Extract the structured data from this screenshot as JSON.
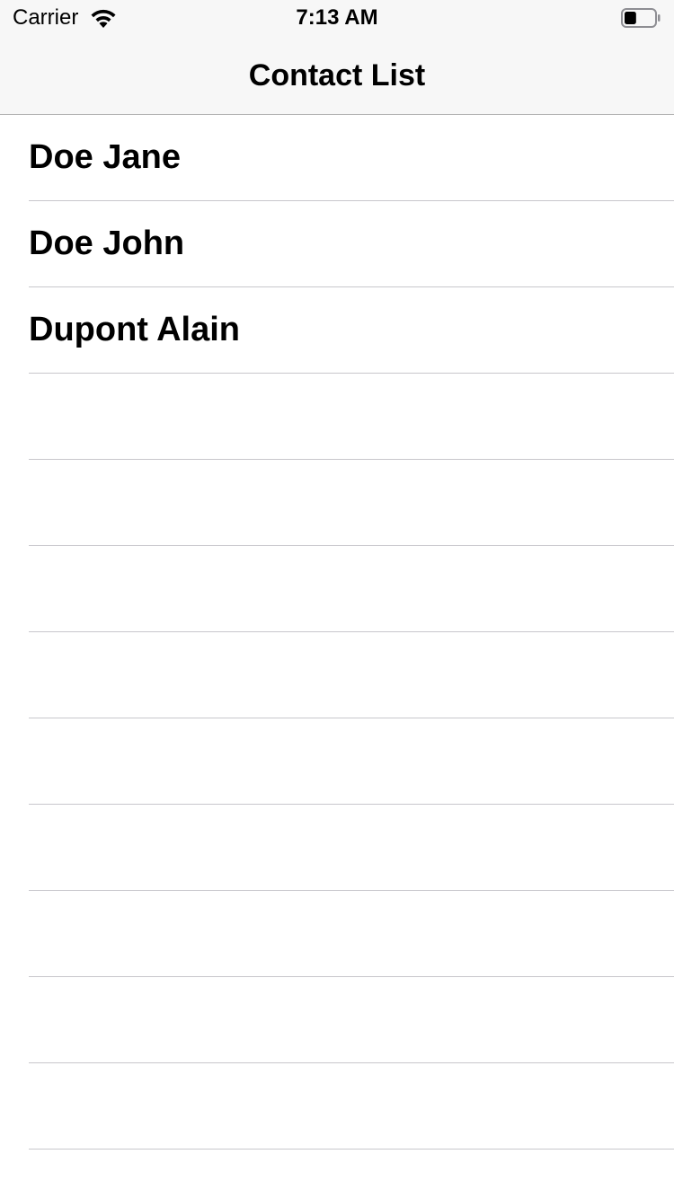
{
  "status_bar": {
    "carrier": "Carrier",
    "time": "7:13 AM",
    "wifi_icon": "wifi-icon",
    "battery_icon": "battery-icon",
    "battery_level": 0.4
  },
  "nav": {
    "title": "Contact List"
  },
  "contacts": [
    {
      "name": "Doe Jane"
    },
    {
      "name": "Doe John"
    },
    {
      "name": "Dupont Alain"
    }
  ],
  "colors": {
    "bar_background": "#f7f7f7",
    "separator": "#c8c7cc",
    "text": "#000000"
  }
}
